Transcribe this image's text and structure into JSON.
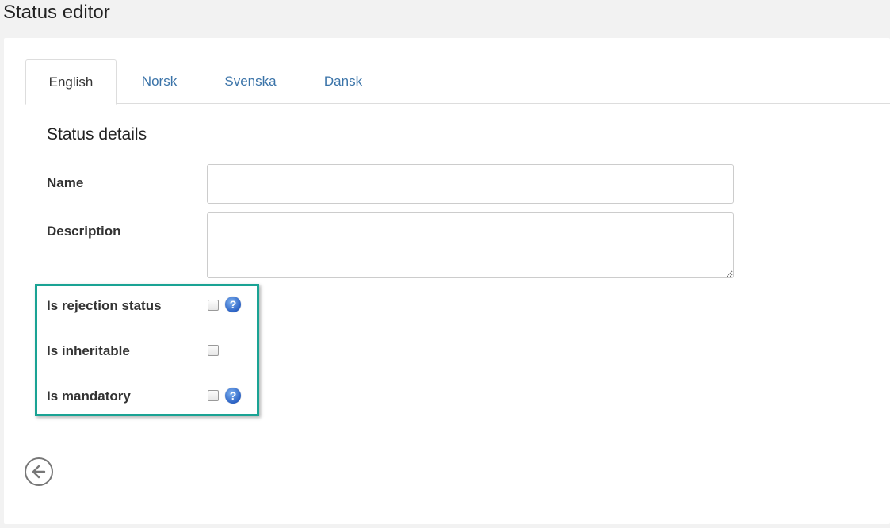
{
  "page": {
    "title": "Status editor"
  },
  "tabs": [
    {
      "label": "English",
      "active": true
    },
    {
      "label": "Norsk",
      "active": false
    },
    {
      "label": "Svenska",
      "active": false
    },
    {
      "label": "Dansk",
      "active": false
    }
  ],
  "form": {
    "section_title": "Status details",
    "name": {
      "label": "Name",
      "value": "",
      "placeholder": ""
    },
    "description": {
      "label": "Description",
      "value": "",
      "placeholder": ""
    },
    "checkboxes": [
      {
        "label": "Is rejection status",
        "checked": false,
        "help": true
      },
      {
        "label": "Is inheritable",
        "checked": false,
        "help": false
      },
      {
        "label": "Is mandatory",
        "checked": false,
        "help": true
      }
    ]
  },
  "icons": {
    "help": "question-mark-icon",
    "back": "arrow-left-circle-icon"
  },
  "colors": {
    "highlight": "#1aa394",
    "link": "#3a73a8",
    "help_icon": "#2b62c4"
  }
}
